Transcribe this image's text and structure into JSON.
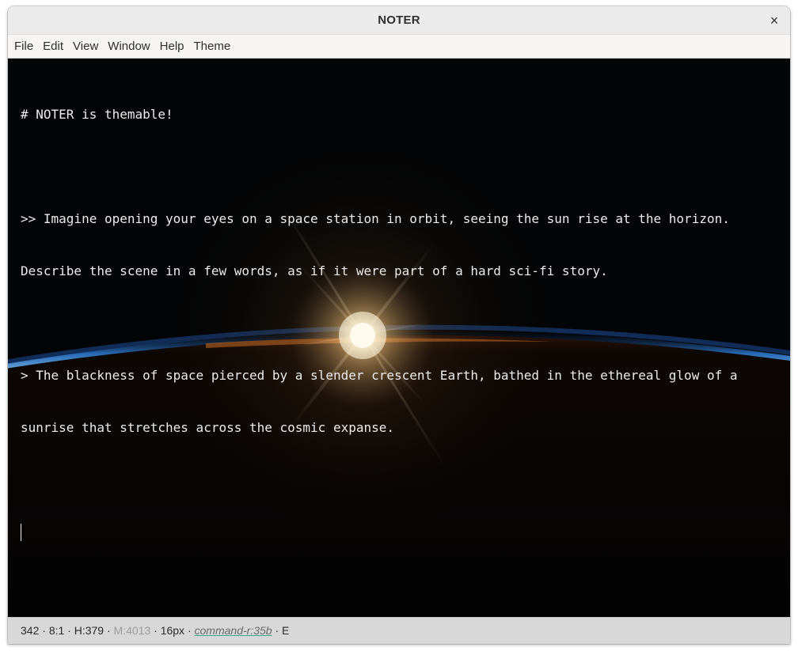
{
  "window": {
    "title": "NOTER",
    "close_glyph": "×"
  },
  "menu": {
    "items": [
      "File",
      "Edit",
      "View",
      "Window",
      "Help",
      "Theme"
    ]
  },
  "editor": {
    "lines": [
      "# NOTER is themable!",
      "",
      ">> Imagine opening your eyes on a space station in orbit, seeing the sun rise at the horizon.",
      "Describe the scene in a few words, as if it were part of a hard sci-fi story.",
      "",
      "> The blackness of space pierced by a slender crescent Earth, bathed in the ethereal glow of a",
      "sunrise that stretches across the cosmic expanse.",
      "",
      ""
    ],
    "background": "earth-sunrise-from-orbit"
  },
  "status": {
    "chars": "342",
    "position": "8:1",
    "h": "H:379",
    "m": "M:4013",
    "font_size": "16px",
    "model": "command-r:35b",
    "mode": "E",
    "sep": " · "
  },
  "colors": {
    "editor_bg": "#030405",
    "editor_text": "#ececec",
    "atmosphere": "#3f8fe0",
    "sun": "#fff4d8",
    "status_underline": "#3aa88a"
  }
}
